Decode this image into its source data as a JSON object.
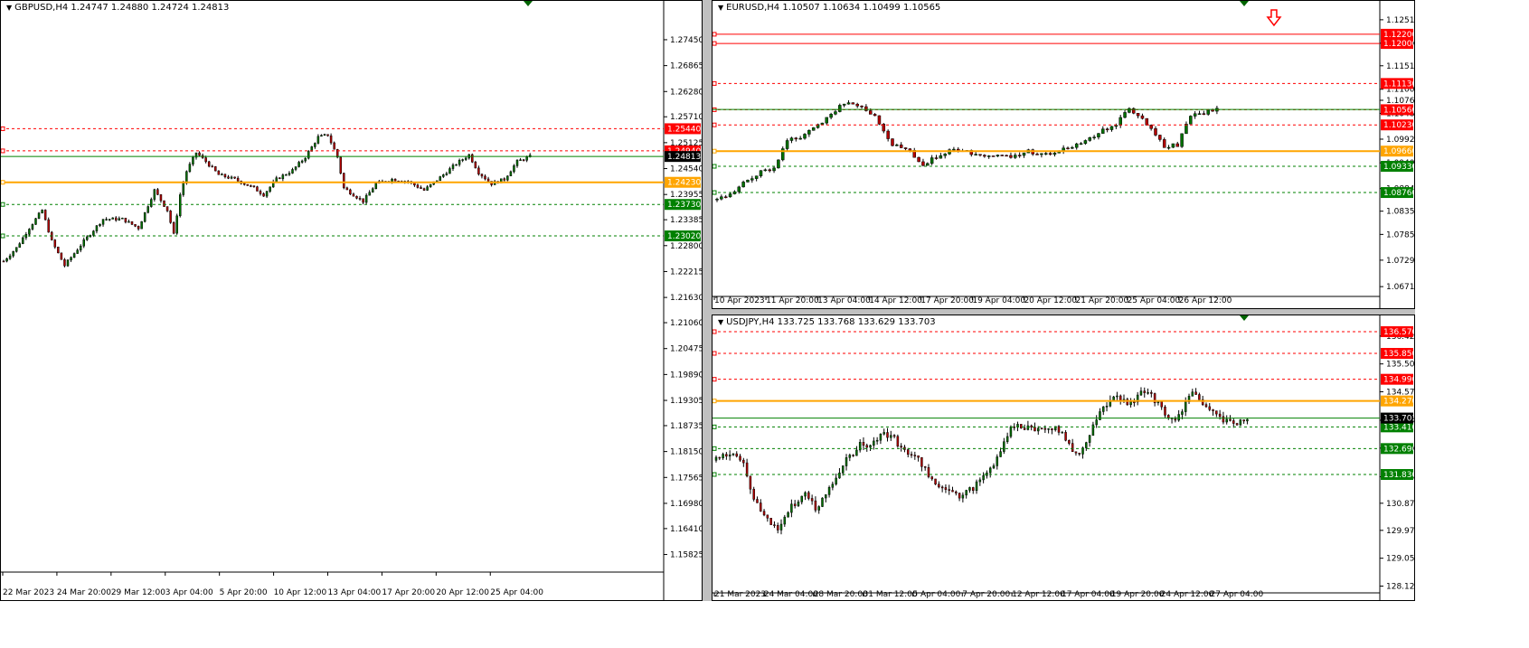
{
  "colors": {
    "background": "#ffffff",
    "grid": "#000000",
    "bull": "#007000",
    "bear": "#b30000",
    "wick": "#000000",
    "resistance": "#ff0000",
    "support": "#008000",
    "pivot": "#ffa500",
    "current": "#008000",
    "arrow": "#ff0000"
  },
  "chart_data": [
    {
      "id": "gbpusd",
      "type": "candlestick",
      "title": "GBPUSD,H4  1.24747 1.24880 1.24724 1.24813",
      "ylim": [
        1.1553,
        1.28
      ],
      "y_ticks": [
        "1.27450",
        "1.26865",
        "1.26280",
        "1.25710",
        "1.25125",
        "1.24540",
        "1.23955",
        "1.23385",
        "1.22800",
        "1.22215",
        "1.21630",
        "1.21060",
        "1.20475",
        "1.19890",
        "1.19305",
        "1.18735",
        "1.18150",
        "1.17565",
        "1.16980",
        "1.16410",
        "1.15825"
      ],
      "x_ticks": [
        "22 Mar 2023",
        "24 Mar 20:00",
        "29 Mar 12:00",
        "3 Apr 04:00",
        "5 Apr 20:00",
        "10 Apr 12:00",
        "13 Apr 04:00",
        "17 Apr 20:00",
        "20 Apr 12:00",
        "25 Apr 04:00"
      ],
      "current": {
        "value": 1.24813,
        "label": "1.24813"
      },
      "levels": [
        {
          "value": 1.2544,
          "label": "1.25440",
          "kind": "resistance"
        },
        {
          "value": 1.2494,
          "label": "1.24940",
          "kind": "resistance"
        },
        {
          "value": 1.2423,
          "label": "1.24230",
          "kind": "pivot"
        },
        {
          "value": 1.2373,
          "label": "1.23730",
          "kind": "support"
        },
        {
          "value": 1.2302,
          "label": "1.23020",
          "kind": "support"
        }
      ],
      "series_path": [
        [
          0,
          1.2245
        ],
        [
          4,
          1.2275
        ],
        [
          8,
          1.232
        ],
        [
          12,
          1.236
        ],
        [
          15,
          1.229
        ],
        [
          19,
          1.2235
        ],
        [
          25,
          1.229
        ],
        [
          31,
          1.234
        ],
        [
          37,
          1.234
        ],
        [
          42,
          1.232
        ],
        [
          47,
          1.2405
        ],
        [
          51,
          1.236
        ],
        [
          53,
          1.2305
        ],
        [
          55,
          1.2395
        ],
        [
          57,
          1.2448
        ],
        [
          60,
          1.249
        ],
        [
          63,
          1.247
        ],
        [
          67,
          1.244
        ],
        [
          72,
          1.243
        ],
        [
          78,
          1.241
        ],
        [
          81,
          1.2395
        ],
        [
          85,
          1.243
        ],
        [
          90,
          1.245
        ],
        [
          94,
          1.248
        ],
        [
          98,
          1.2525
        ],
        [
          101,
          1.253
        ],
        [
          104,
          1.248
        ],
        [
          106,
          1.241
        ],
        [
          109,
          1.2395
        ],
        [
          112,
          1.238
        ],
        [
          116,
          1.242
        ],
        [
          121,
          1.243
        ],
        [
          126,
          1.2425
        ],
        [
          131,
          1.2405
        ],
        [
          137,
          1.244
        ],
        [
          141,
          1.2465
        ],
        [
          145,
          1.2485
        ],
        [
          148,
          1.2445
        ],
        [
          152,
          1.242
        ],
        [
          156,
          1.243
        ],
        [
          160,
          1.247
        ],
        [
          164,
          1.2481
        ]
      ]
    },
    {
      "id": "eurusd",
      "type": "candlestick",
      "title": "EURUSD,H4  1.10507 1.10634 1.10499 1.10565",
      "ylim": [
        1.066,
        1.1265
      ],
      "y_ticks": [
        "1.12515",
        "1.12005",
        "1.11515",
        "1.11005",
        "1.10765",
        "1.10480",
        "1.09920",
        "1.09405",
        "1.08845",
        "1.08355",
        "1.07850",
        "1.07290",
        "1.06715"
      ],
      "x_ticks": [
        "10 Apr 2023",
        "11 Apr 20:00",
        "13 Apr 04:00",
        "14 Apr 12:00",
        "17 Apr 20:00",
        "19 Apr 04:00",
        "20 Apr 12:00",
        "21 Apr 20:00",
        "25 Apr 04:00",
        "26 Apr 12:00"
      ],
      "current": {
        "value": 1.10565,
        "label": ""
      },
      "levels": [
        {
          "value": 1.122,
          "label": "1.12200",
          "kind": "resistance",
          "solid": true
        },
        {
          "value": 1.12,
          "label": "1.12000",
          "kind": "resistance",
          "solid": true
        },
        {
          "value": 1.1113,
          "label": "1.11130",
          "kind": "resistance"
        },
        {
          "value": 1.1056,
          "label": "1.10560",
          "kind": "resistance"
        },
        {
          "value": 1.1023,
          "label": "1.10230",
          "kind": "resistance"
        },
        {
          "value": 1.0966,
          "label": "1.09660",
          "kind": "pivot"
        },
        {
          "value": 1.0933,
          "label": "1.09330",
          "kind": "support"
        },
        {
          "value": 1.0876,
          "label": "1.08760",
          "kind": "support"
        }
      ],
      "arrow": {
        "x": 127,
        "direction": "down"
      },
      "series_path": [
        [
          0,
          1.086
        ],
        [
          3,
          1.087
        ],
        [
          6,
          1.0895
        ],
        [
          10,
          1.092
        ],
        [
          13,
          1.093
        ],
        [
          16,
          1.099
        ],
        [
          20,
          1.1
        ],
        [
          24,
          1.103
        ],
        [
          27,
          1.1055
        ],
        [
          30,
          1.1075
        ],
        [
          33,
          1.1065
        ],
        [
          36,
          1.104
        ],
        [
          40,
          1.098
        ],
        [
          44,
          1.0965
        ],
        [
          47,
          1.0935
        ],
        [
          51,
          1.096
        ],
        [
          55,
          1.097
        ],
        [
          59,
          1.096
        ],
        [
          63,
          1.0955
        ],
        [
          67,
          1.0955
        ],
        [
          71,
          1.0965
        ],
        [
          75,
          1.096
        ],
        [
          79,
          1.097
        ],
        [
          83,
          1.0985
        ],
        [
          87,
          1.1005
        ],
        [
          91,
          1.1025
        ],
        [
          94,
          1.106
        ],
        [
          97,
          1.1035
        ],
        [
          100,
          1.1
        ],
        [
          102,
          1.0975
        ],
        [
          105,
          1.098
        ],
        [
          108,
          1.1045
        ],
        [
          111,
          1.105
        ],
        [
          114,
          1.1056
        ]
      ]
    },
    {
      "id": "usdjpy",
      "type": "candlestick",
      "title": "USDJPY,H4  133.725 133.768 133.629 133.703",
      "ylim": [
        128.05,
        136.75
      ],
      "y_ticks": [
        "136.425",
        "135.500",
        "134.575",
        "133.630",
        "132.705",
        "131.755",
        "130.875",
        "129.975",
        "129.050",
        "128.125"
      ],
      "x_ticks": [
        "21 Mar 2023",
        "24 Mar 04:00",
        "28 Mar 20:00",
        "31 Mar 12:00",
        "5 Apr 04:00",
        "7 Apr 20:00",
        "12 Apr 12:00",
        "17 Apr 04:00",
        "19 Apr 20:00",
        "24 Apr 12:00",
        "27 Apr 04:00"
      ],
      "current": {
        "value": 133.703,
        "label": "133.703"
      },
      "levels": [
        {
          "value": 136.57,
          "label": "136.570",
          "kind": "resistance"
        },
        {
          "value": 135.85,
          "label": "135.850",
          "kind": "resistance"
        },
        {
          "value": 134.99,
          "label": "134.990",
          "kind": "resistance"
        },
        {
          "value": 134.27,
          "label": "134.270",
          "kind": "pivot"
        },
        {
          "value": 133.41,
          "label": "133.410",
          "kind": "support"
        },
        {
          "value": 132.69,
          "label": "132.690",
          "kind": "support"
        },
        {
          "value": 131.83,
          "label": "131.830",
          "kind": "support"
        }
      ],
      "series_path": [
        [
          0,
          132.3
        ],
        [
          5,
          132.6
        ],
        [
          8,
          132.2
        ],
        [
          11,
          131.0
        ],
        [
          15,
          130.4
        ],
        [
          18,
          129.9
        ],
        [
          21,
          130.6
        ],
        [
          26,
          131.3
        ],
        [
          29,
          130.7
        ],
        [
          33,
          131.3
        ],
        [
          37,
          132.2
        ],
        [
          42,
          132.8
        ],
        [
          45,
          132.85
        ],
        [
          49,
          133.2
        ],
        [
          52,
          133.0
        ],
        [
          55,
          132.6
        ],
        [
          58,
          132.5
        ],
        [
          61,
          132.0
        ],
        [
          64,
          131.5
        ],
        [
          68,
          131.2
        ],
        [
          71,
          131.15
        ],
        [
          75,
          131.4
        ],
        [
          79,
          131.9
        ],
        [
          83,
          132.5
        ],
        [
          86,
          133.5
        ],
        [
          90,
          133.4
        ],
        [
          94,
          133.35
        ],
        [
          98,
          133.4
        ],
        [
          101,
          133.2
        ],
        [
          104,
          132.6
        ],
        [
          106,
          132.4
        ],
        [
          109,
          133.2
        ],
        [
          112,
          133.9
        ],
        [
          115,
          134.3
        ],
        [
          118,
          134.35
        ],
        [
          121,
          134.2
        ],
        [
          124,
          134.6
        ],
        [
          127,
          134.45
        ],
        [
          130,
          134.0
        ],
        [
          133,
          133.6
        ],
        [
          136,
          134.0
        ],
        [
          139,
          134.5
        ],
        [
          142,
          134.2
        ],
        [
          145,
          133.9
        ],
        [
          148,
          133.6
        ],
        [
          152,
          133.5
        ],
        [
          155,
          133.7
        ]
      ]
    }
  ]
}
